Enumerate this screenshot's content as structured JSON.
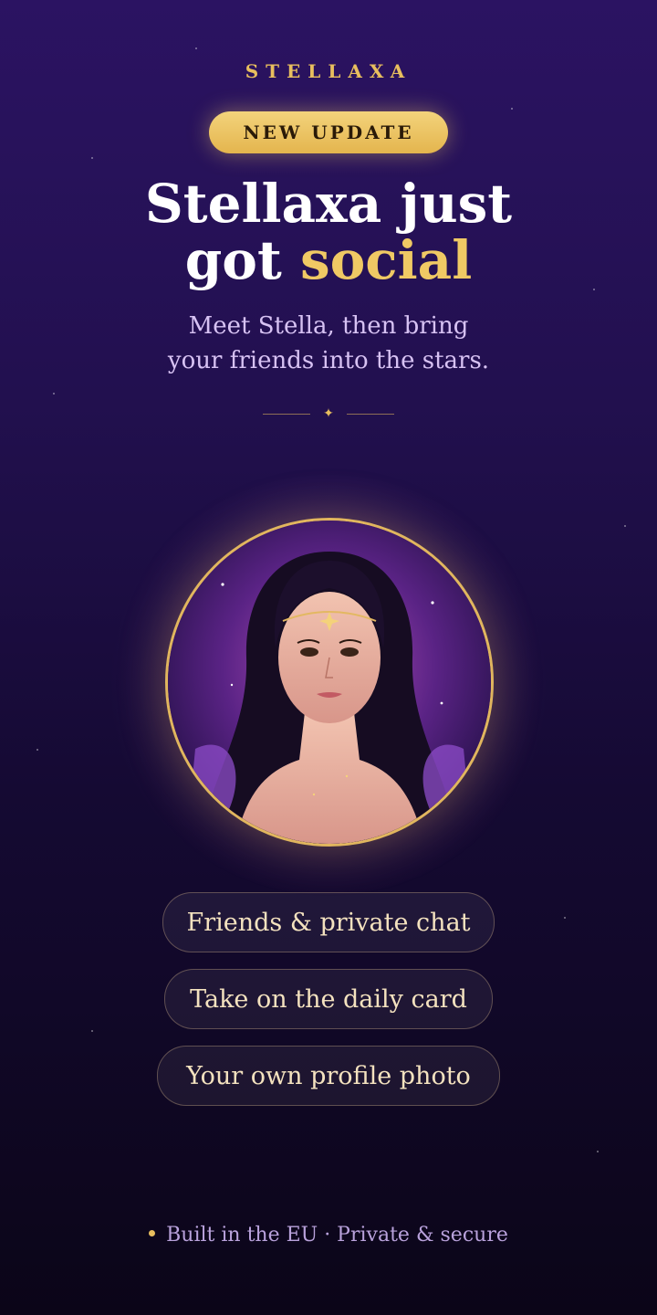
{
  "brand": {
    "name": "STELLAXA"
  },
  "badge": {
    "label": "NEW UPDATE"
  },
  "headline": {
    "line1": "Stellaxa just",
    "line2_prefix": "got ",
    "line2_accent": "social"
  },
  "subtitle": {
    "line1": "Meet Stella, then bring",
    "line2": "your friends into the stars."
  },
  "divider": {
    "icon": "sparkle-icon"
  },
  "avatar": {
    "subject": "Stella"
  },
  "features": [
    {
      "label": "Friends & private chat"
    },
    {
      "label": "Take on the daily card"
    },
    {
      "label": "Your own profile photo"
    }
  ],
  "footer": {
    "text": "Built in the EU · Private & secure"
  },
  "colors": {
    "accent": "#e8be5e",
    "background_top": "#2b1362",
    "background_bottom": "#0b0518"
  }
}
